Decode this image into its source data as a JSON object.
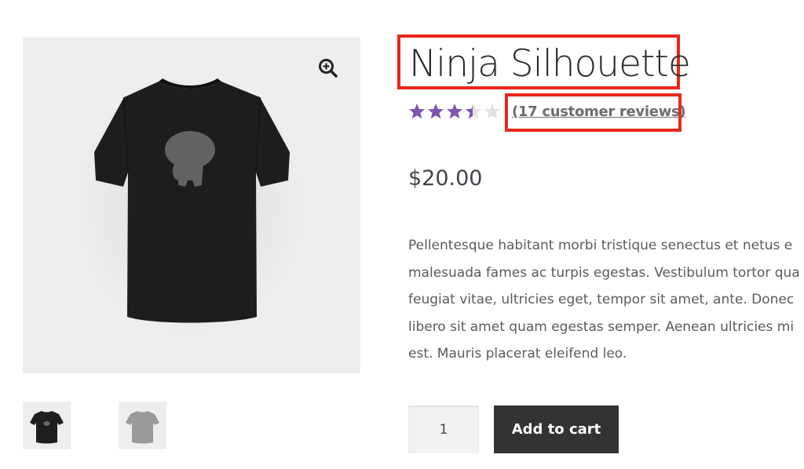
{
  "product": {
    "title": "Ninja Silhouette",
    "rating": 3.5,
    "rating_max": 5,
    "reviews_link": "(17 customer reviews)",
    "price": "$20.00",
    "description_lines": [
      "Pellentesque habitant morbi tristique senectus et netus e",
      "malesuada fames ac turpis egestas. Vestibulum tortor qua",
      "feugiat vitae, ultricies eget, tempor sit amet, ante. Donec",
      "libero sit amet quam egestas semper. Aenean ultricies mi",
      "est. Mauris placerat eleifend leo."
    ]
  },
  "gallery": {
    "zoom_icon": "magnifier-zoom-icon",
    "thumbnails": [
      {
        "name": "black-tshirt-thumbnail",
        "shirt_color": "#1e1e1e"
      },
      {
        "name": "gray-tshirt-thumbnail",
        "shirt_color": "#9a9a9a"
      }
    ]
  },
  "cart": {
    "quantity": "1",
    "add_to_cart_label": "Add to cart"
  },
  "colors": {
    "highlight_border": "#e8281c",
    "star_filled": "#7f54b3",
    "star_empty": "#e2e2e2",
    "button_bg": "#333333"
  }
}
